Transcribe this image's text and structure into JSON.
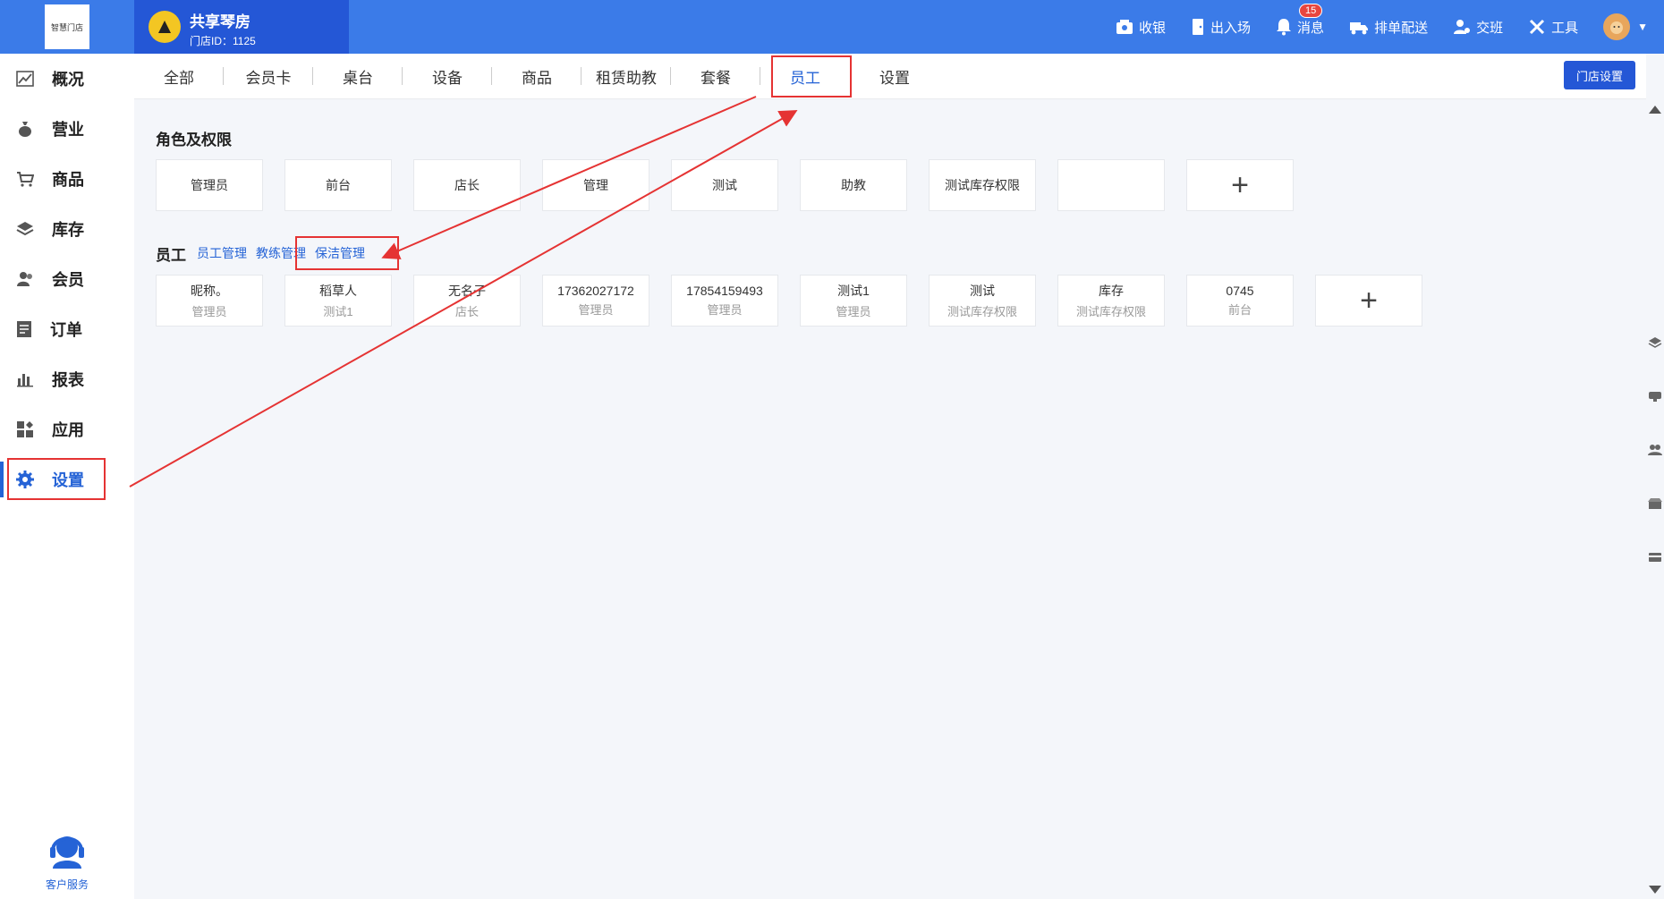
{
  "app": {
    "logo_text": "智慧门店"
  },
  "store": {
    "name": "共享琴房",
    "id_text": "门店ID：1125"
  },
  "top_actions": [
    {
      "label": "收银",
      "icon": "cashier-icon"
    },
    {
      "label": "出入场",
      "icon": "door-icon"
    },
    {
      "label": "消息",
      "icon": "bell-icon",
      "badge": "15"
    },
    {
      "label": "排单配送",
      "icon": "delivery-icon"
    },
    {
      "label": "交班",
      "icon": "handover-icon"
    },
    {
      "label": "工具",
      "icon": "tools-icon"
    }
  ],
  "sidebar": {
    "items": [
      {
        "label": "概况",
        "icon": "chart-line-icon"
      },
      {
        "label": "营业",
        "icon": "money-bag-icon"
      },
      {
        "label": "商品",
        "icon": "cart-icon"
      },
      {
        "label": "库存",
        "icon": "layers-icon"
      },
      {
        "label": "会员",
        "icon": "users-icon"
      },
      {
        "label": "订单",
        "icon": "order-icon"
      },
      {
        "label": "报表",
        "icon": "bar-chart-icon"
      },
      {
        "label": "应用",
        "icon": "apps-icon"
      },
      {
        "label": "设置",
        "icon": "gear-icon",
        "active": true
      }
    ],
    "customer_service": "客户服务"
  },
  "tabs": [
    "全部",
    "会员卡",
    "桌台",
    "设备",
    "商品",
    "租赁助教",
    "套餐",
    "员工",
    "设置"
  ],
  "active_tab": "员工",
  "store_settings_button": "门店设置",
  "roles": {
    "title": "角色及权限",
    "items": [
      "管理员",
      "前台",
      "店长",
      "管理",
      "测试",
      "助教",
      "测试库存权限",
      ""
    ]
  },
  "staff": {
    "title": "员工",
    "links": [
      "员工管理",
      "教练管理",
      "保洁管理"
    ],
    "items": [
      {
        "name": "昵称。",
        "role": "管理员"
      },
      {
        "name": "稻草人",
        "role": "测试1"
      },
      {
        "name": "无名子",
        "role": "店长"
      },
      {
        "name": "17362027172",
        "role": "管理员"
      },
      {
        "name": "17854159493",
        "role": "管理员"
      },
      {
        "name": "测试1",
        "role": "管理员"
      },
      {
        "name": "测试",
        "role": "测试库存权限"
      },
      {
        "name": "库存",
        "role": "测试库存权限"
      },
      {
        "name": "0745",
        "role": "前台"
      }
    ]
  },
  "colors": {
    "primary": "#3b7be8",
    "primary_dark": "#2457d6",
    "annotation": "#e53333"
  }
}
